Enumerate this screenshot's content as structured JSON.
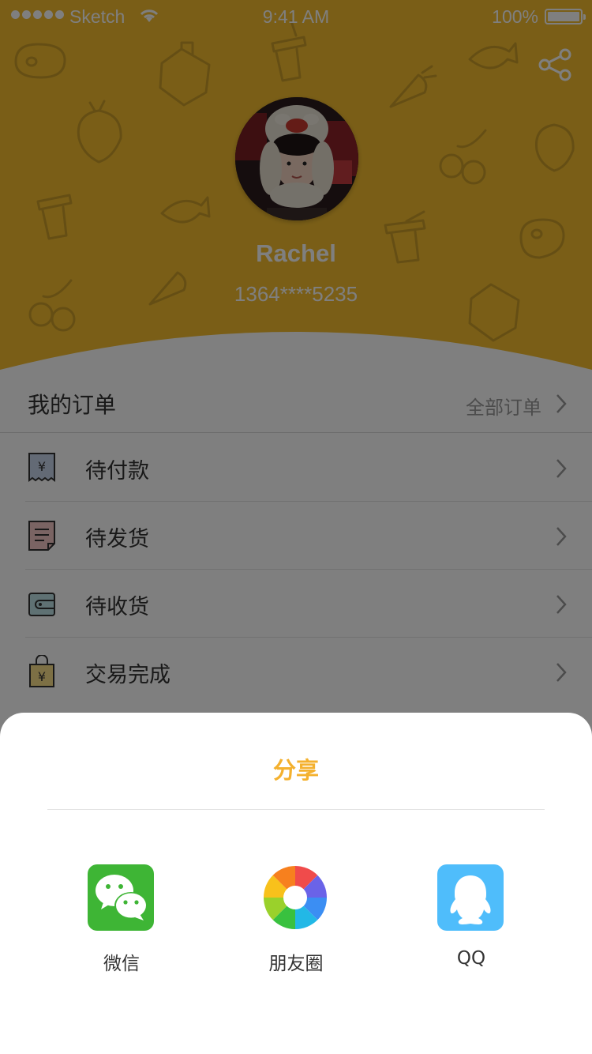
{
  "status_bar": {
    "carrier": "Sketch",
    "time": "9:41 AM",
    "battery": "100%"
  },
  "profile": {
    "name": "Rachel",
    "phone": "1364****5235"
  },
  "orders": {
    "title": "我的订单",
    "all_label": "全部订单",
    "items": [
      {
        "label": "待付款",
        "icon": "pay-receipt-icon"
      },
      {
        "label": "待发货",
        "icon": "document-icon"
      },
      {
        "label": "待收货",
        "icon": "wallet-icon"
      },
      {
        "label": "交易完成",
        "icon": "shopping-bag-icon"
      }
    ]
  },
  "share_sheet": {
    "title": "分享",
    "items": [
      {
        "label": "微信",
        "icon": "wechat-icon"
      },
      {
        "label": "朋友圈",
        "icon": "moments-icon"
      },
      {
        "label": "QQ",
        "icon": "qq-icon"
      }
    ]
  },
  "colors": {
    "header_yellow": "#f4bd2f",
    "accent": "#f4b12f",
    "wechat_green": "#3eb535",
    "qq_blue": "#4fbdfb"
  }
}
